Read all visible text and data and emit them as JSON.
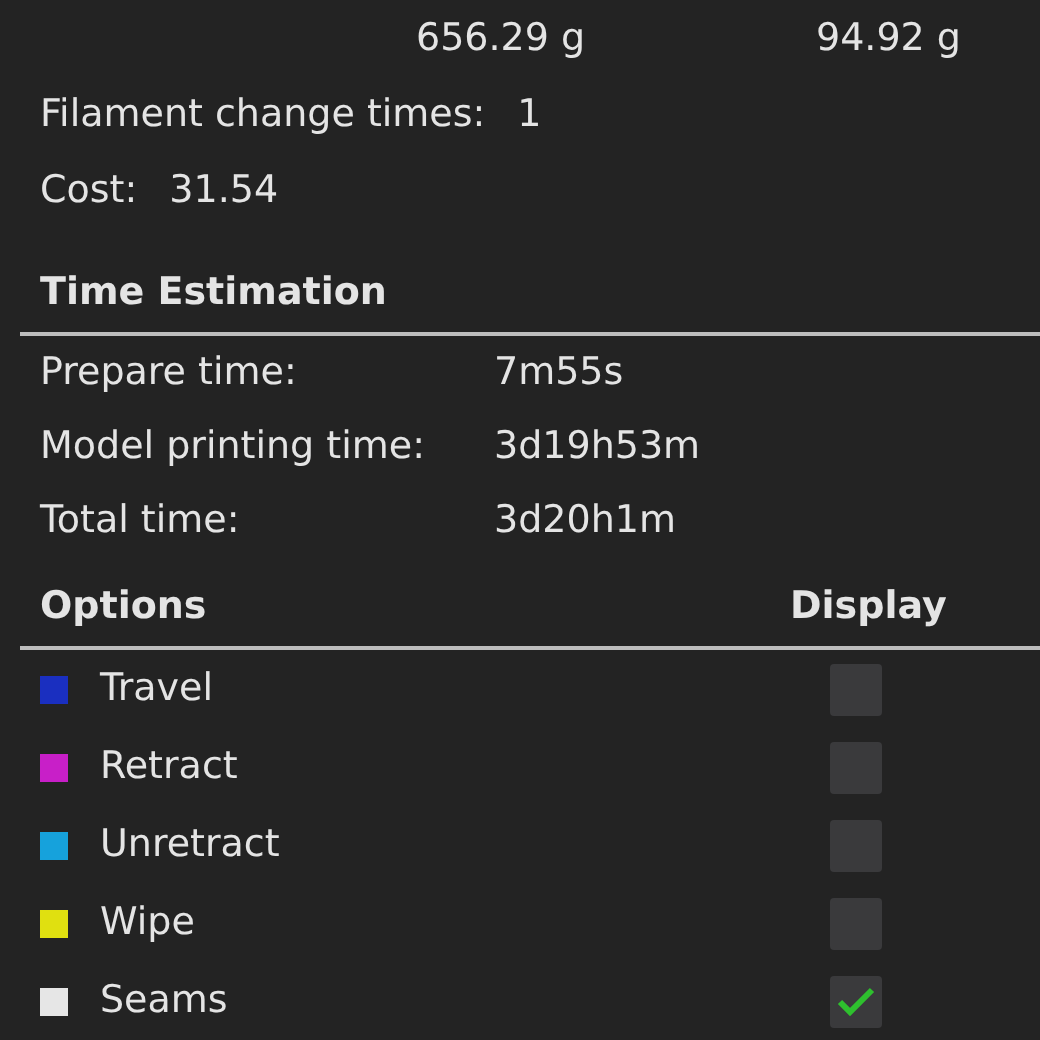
{
  "weights": [
    "656.29 g",
    "94.92 g"
  ],
  "summary": [
    {
      "label": "Filament change times:",
      "value": "1"
    },
    {
      "label": "Cost:",
      "value": "31.54"
    }
  ],
  "time_estimation": {
    "title": "Time Estimation",
    "rows": [
      {
        "label": "Prepare time:",
        "value": "7m55s"
      },
      {
        "label": "Model printing time:",
        "value": "3d19h53m"
      },
      {
        "label": "Total time:",
        "value": "3d20h1m"
      }
    ]
  },
  "options": {
    "title": "Options",
    "display_header": "Display",
    "items": [
      {
        "name": "Travel",
        "color": "#1a2fc0",
        "checked": false
      },
      {
        "name": "Retract",
        "color": "#c81fc8",
        "checked": false
      },
      {
        "name": "Unretract",
        "color": "#16a2dc",
        "checked": false
      },
      {
        "name": "Wipe",
        "color": "#e0e010",
        "checked": false
      },
      {
        "name": "Seams",
        "color": "#e6e6e6",
        "checked": true
      }
    ]
  }
}
